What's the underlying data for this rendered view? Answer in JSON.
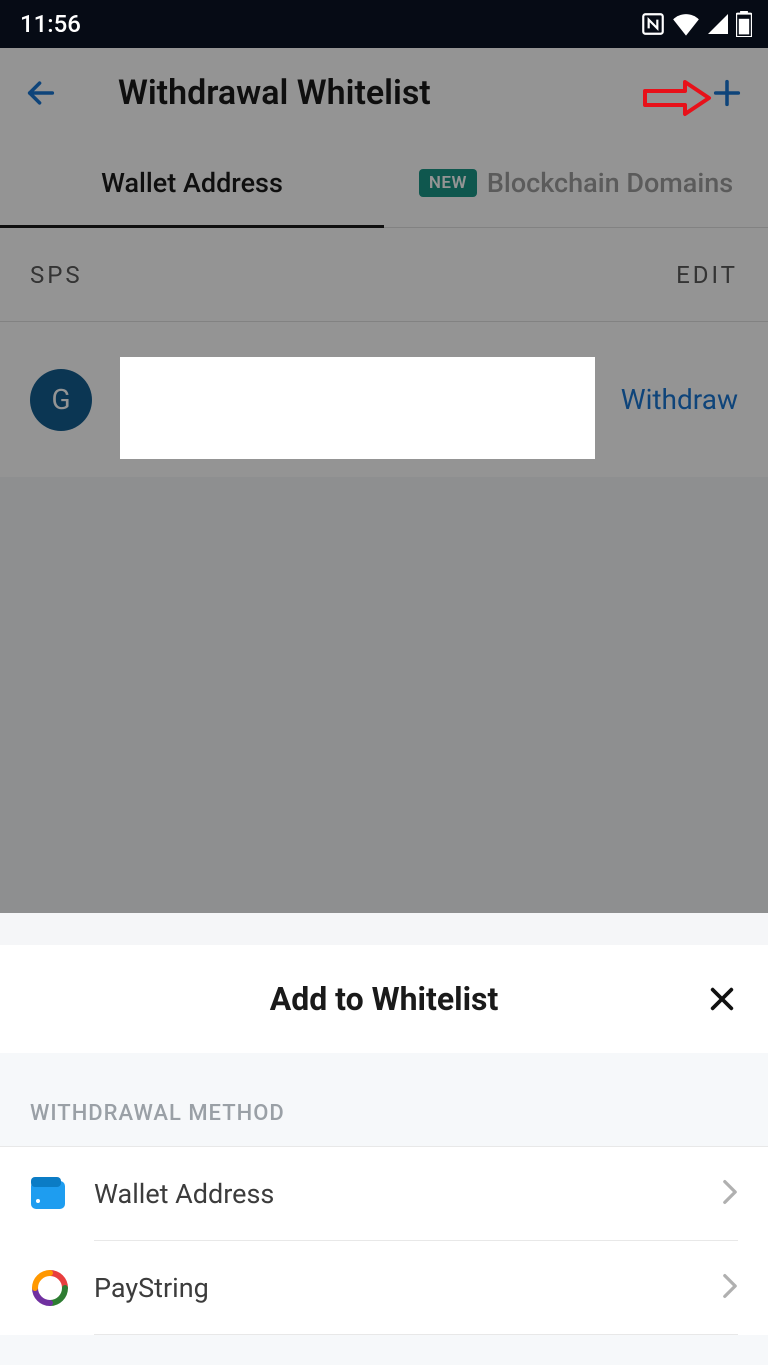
{
  "status": {
    "time": "11:56"
  },
  "header": {
    "title": "Withdrawal Whitelist"
  },
  "tabs": {
    "wallet_address": "Wallet Address",
    "blockchain_domains": "Blockchain Domains",
    "new_badge": "NEW"
  },
  "section": {
    "label": "SPS",
    "edit": "EDIT"
  },
  "list": {
    "avatar_letter": "G",
    "withdraw": "Withdraw"
  },
  "sheet": {
    "title": "Add to Whitelist",
    "section_label": "WITHDRAWAL METHOD",
    "methods": [
      {
        "name": "Wallet Address"
      },
      {
        "name": "PayString"
      }
    ]
  }
}
